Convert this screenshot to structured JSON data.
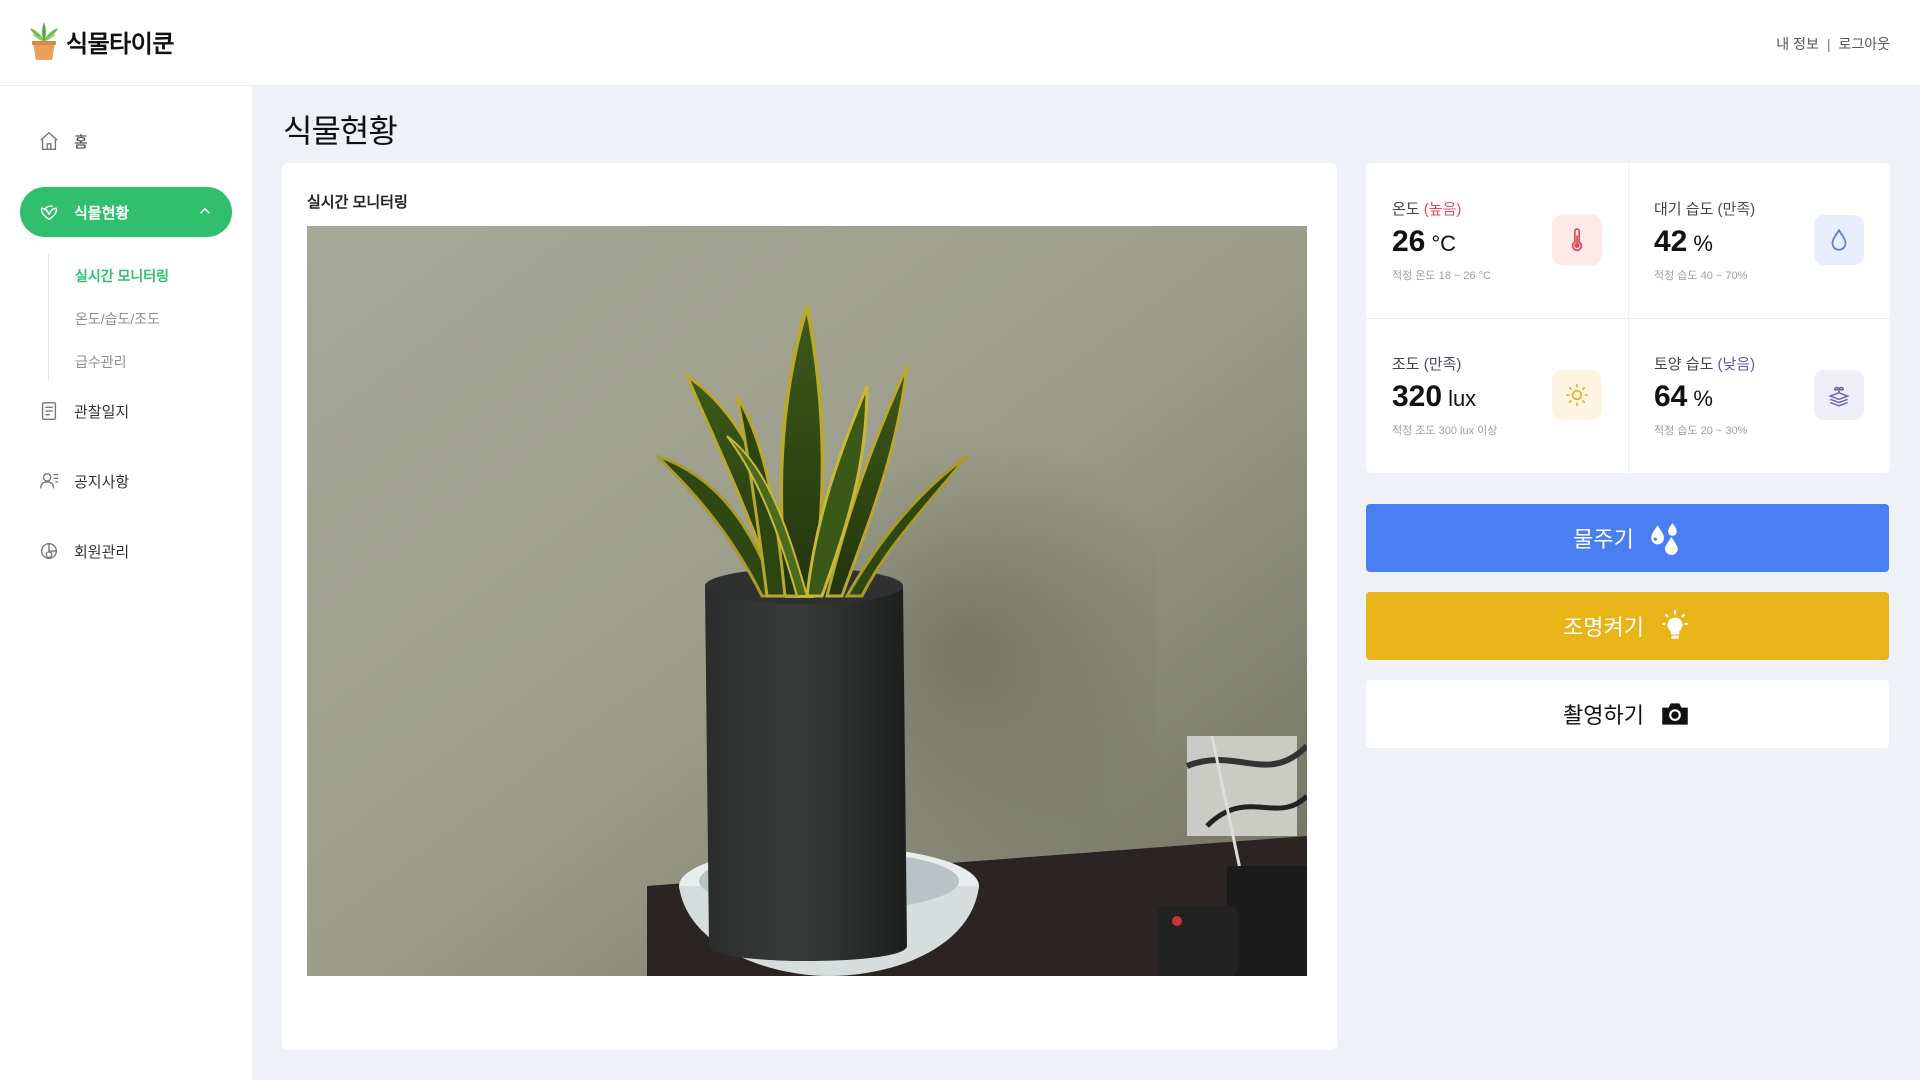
{
  "app": {
    "name": "식물타이쿤"
  },
  "header": {
    "my_info": "내 정보",
    "separator": "|",
    "logout": "로그아웃"
  },
  "sidebar": {
    "items": [
      {
        "label": "홈",
        "icon": "home-icon"
      },
      {
        "label": "식물현황",
        "icon": "plant-icon",
        "active": true
      },
      {
        "label": "관찰일지",
        "icon": "journal-icon"
      },
      {
        "label": "공지사항",
        "icon": "notice-icon"
      },
      {
        "label": "회원관리",
        "icon": "member-icon"
      }
    ],
    "sub_items": [
      {
        "label": "실시간 모니터링",
        "active": true
      },
      {
        "label": "온도/습도/조도"
      },
      {
        "label": "급수관리"
      }
    ]
  },
  "page": {
    "title": "식물현황"
  },
  "monitor": {
    "title": "실시간 모니터링"
  },
  "stats": {
    "temperature": {
      "name": "온도",
      "status": "(높음)",
      "value": "26",
      "unit": "°C",
      "range": "적정 온도 18 ~ 26 °C",
      "icon": "thermometer-icon"
    },
    "air_humidity": {
      "name": "대기 습도",
      "status": "(만족)",
      "value": "42",
      "unit": "%",
      "range": "적정 습도 40 ~ 70%",
      "icon": "droplet-icon"
    },
    "illuminance": {
      "name": "조도",
      "status": "(만족)",
      "value": "320",
      "unit": "lux",
      "range": "적정 조도 300 lux 이상",
      "icon": "sun-icon"
    },
    "soil_humidity": {
      "name": "토양 습도",
      "status": "(낮음)",
      "value": "64",
      "unit": "%",
      "range": "적정 습도 20 ~ 30%",
      "icon": "soil-icon"
    }
  },
  "actions": {
    "water": {
      "label": "물주기",
      "icon": "water-drops-icon",
      "color": "#4a7ff3"
    },
    "light": {
      "label": "조명켜기",
      "icon": "lightbulb-icon",
      "color": "#e8b418"
    },
    "photo": {
      "label": "촬영하기",
      "icon": "camera-icon",
      "color": "#ffffff"
    }
  },
  "colors": {
    "accent": "#2fbf6d",
    "status_high": "#e0485c",
    "status_low": "#5a5aa8"
  }
}
